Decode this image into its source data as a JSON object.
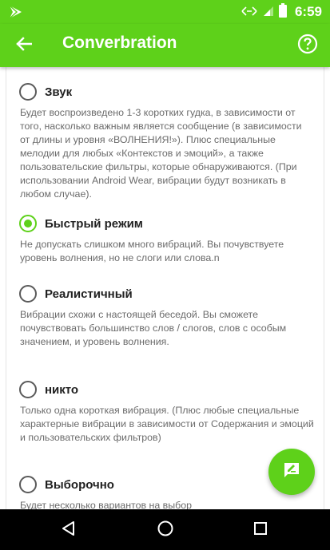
{
  "status_bar": {
    "time": "6:59"
  },
  "app_bar": {
    "title": "Converbration"
  },
  "options": [
    {
      "label": "Звук",
      "checked": false,
      "description": "Будет воспроизведено 1-3 коротких гудка, в зависимости от того, насколько важным является сообщение (в зависимости от длины и уровня «ВОЛНЕНИЯ!»). Плюс специальные мелодии для любых «Контекстов и эмоций», а также пользовательские фильтры, которые обнаруживаются. (При использовании Android Wear, вибрации будут возникать в любом случае)."
    },
    {
      "label": "Быстрый режим",
      "checked": true,
      "description": "Не допускать слишком много вибраций. Вы почувствуете уровень волнения, но не слоги или слова.n"
    },
    {
      "label": "Реалистичный",
      "checked": false,
      "description": "Вибрации схожи с настоящей беседой. Вы сможете почувствовать большинство слов / слогов, слов с особым значением, и уровень волнения."
    },
    {
      "label": "никто",
      "checked": false,
      "description": "Только одна короткая вибрация. (Плюс любые специальные характерные вибрации в зависимости от Содержания и эмоций и пользовательских фильтров)"
    },
    {
      "label": "Выборочно",
      "checked": false,
      "description": "Будет несколько вариантов на выбор"
    }
  ],
  "colors": {
    "accent": "#5ed11a",
    "nav_bar": "#000000",
    "description_text": "#6b6b6b"
  },
  "icons": {
    "status_left": "play-store-icon",
    "wifi": "data-transfer-icon",
    "signal": "signal-icon",
    "battery": "battery-icon",
    "back": "arrow-left-icon",
    "help": "help-circle-icon",
    "fab": "edit-message-icon"
  }
}
